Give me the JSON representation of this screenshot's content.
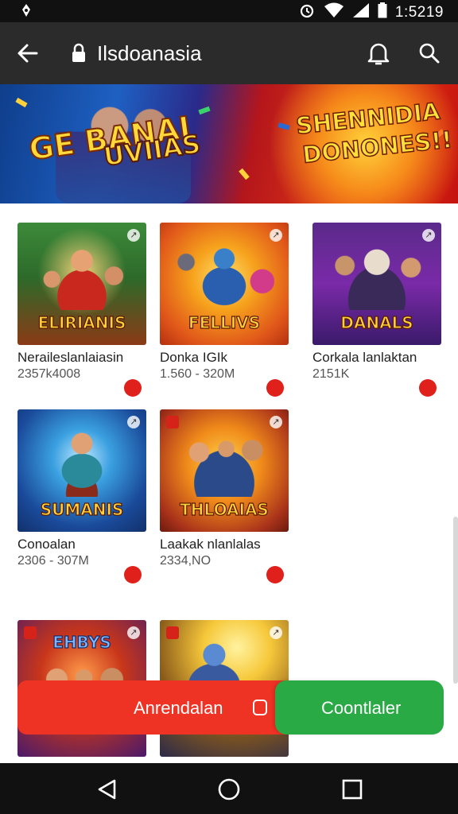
{
  "status_bar": {
    "time": "1:5219",
    "icons": [
      "notification-icon",
      "alarm-icon",
      "wifi-icon",
      "signal-icon",
      "battery-icon"
    ]
  },
  "toolbar": {
    "title": "Ilsdoanasia",
    "icons": [
      "back-arrow-icon",
      "lock-icon",
      "bell-icon",
      "search-icon"
    ]
  },
  "banner": {
    "left_title_line1": "GE BANAI",
    "left_title_line2": "UVIIAS",
    "right_title_line1": "SHENNIDIA",
    "right_title_line2": "DONONES!!"
  },
  "games": [
    {
      "name": "Neraileslanlaiasin",
      "meta": "2357k4008",
      "logo": "ELIRIANIS",
      "badge": "•"
    },
    {
      "name": "Donka IGIk",
      "meta": "1.560 - 320M",
      "logo": "FELLIVS",
      "badge": "•"
    },
    {
      "name": "Corkala lanlaktan",
      "meta": "2151K",
      "logo": "DANALS",
      "badge": "•"
    },
    {
      "name": "Conoalan",
      "meta": "2306 - 307M",
      "logo": "SUMANIS",
      "badge": "•"
    },
    {
      "name": "Laakak nlanlalas",
      "meta": "2334,NO",
      "logo": "THLOAIAS",
      "badge": "•"
    },
    {
      "name": "",
      "meta": "",
      "logo": "EHBYS",
      "badge": ""
    },
    {
      "name": "",
      "meta": "",
      "logo": "",
      "badge": ""
    }
  ],
  "actions": {
    "primary_label": "Anrendalan",
    "secondary_label": "Coontlaler"
  },
  "nav_bar": {
    "icons": [
      "back-triangle-icon",
      "home-circle-icon",
      "recents-square-icon"
    ]
  },
  "colors": {
    "toolbar_bg": "#2b2b2b",
    "primary_red": "#ee3224",
    "secondary_green": "#2aaa45",
    "banner_blue": "#1e60c2",
    "banner_red": "#e23a14"
  }
}
